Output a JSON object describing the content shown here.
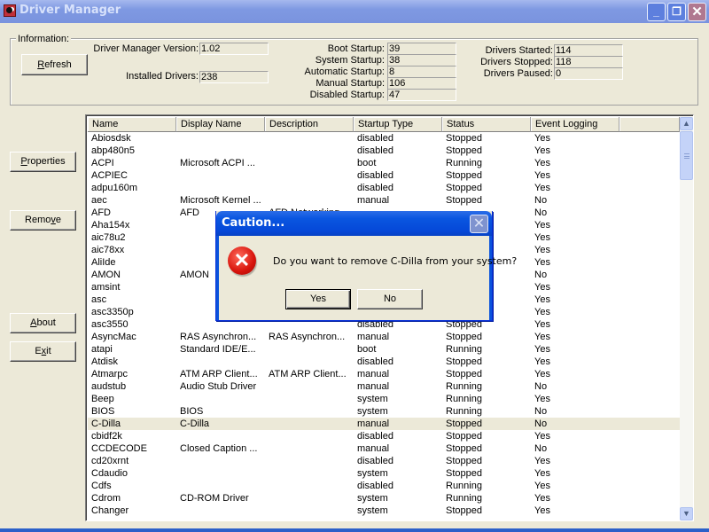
{
  "window": {
    "title": "Driver Manager",
    "controls": {
      "minimize": "_",
      "maximize": "❐",
      "close": "✕"
    }
  },
  "info": {
    "group_label": "Information:",
    "refresh_label_pre": "",
    "refresh_label_ul": "R",
    "refresh_label_post": "efresh",
    "version_label": "Driver Manager Version:",
    "version_value": "1.02",
    "installed_label": "Installed Drivers:",
    "installed_value": "238",
    "startup": [
      {
        "label": "Boot Startup:",
        "value": "39"
      },
      {
        "label": "System Startup:",
        "value": "38"
      },
      {
        "label": "Automatic Startup:",
        "value": "8"
      },
      {
        "label": "Manual Startup:",
        "value": "106"
      },
      {
        "label": "Disabled Startup:",
        "value": "47"
      }
    ],
    "status": [
      {
        "label": "Drivers Started:",
        "value": "114"
      },
      {
        "label": "Drivers Stopped:",
        "value": "118"
      },
      {
        "label": "Drivers Paused:",
        "value": "0"
      }
    ]
  },
  "side_buttons": {
    "properties": {
      "pre": "",
      "ul": "P",
      "post": "roperties"
    },
    "remove": {
      "pre": "Remo",
      "ul": "v",
      "post": "e"
    },
    "about": {
      "pre": "",
      "ul": "A",
      "post": "bout"
    },
    "exit": {
      "pre": "E",
      "ul": "x",
      "post": "it"
    }
  },
  "list": {
    "columns": [
      "Name",
      "Display Name",
      "Description",
      "Startup Type",
      "Status",
      "Event Logging",
      ""
    ],
    "selected_index": 23,
    "rows": [
      [
        "Abiosdsk",
        "",
        "",
        "disabled",
        "Stopped",
        "Yes"
      ],
      [
        "abp480n5",
        "",
        "",
        "disabled",
        "Stopped",
        "Yes"
      ],
      [
        "ACPI",
        "Microsoft ACPI ...",
        "",
        "boot",
        "Running",
        "Yes"
      ],
      [
        "ACPIEC",
        "",
        "",
        "disabled",
        "Stopped",
        "Yes"
      ],
      [
        "adpu160m",
        "",
        "",
        "disabled",
        "Stopped",
        "Yes"
      ],
      [
        "aec",
        "Microsoft Kernel ...",
        "",
        "manual",
        "Stopped",
        "No"
      ],
      [
        "AFD",
        "AFD",
        "AFD Networking ...",
        "",
        "",
        "No"
      ],
      [
        "Aha154x",
        "",
        "",
        "",
        "",
        "Yes"
      ],
      [
        "aic78u2",
        "",
        "",
        "",
        "",
        "Yes"
      ],
      [
        "aic78xx",
        "",
        "",
        "",
        "",
        "Yes"
      ],
      [
        "AliIde",
        "",
        "",
        "",
        "",
        "Yes"
      ],
      [
        "AMON",
        "AMON",
        "",
        "",
        "",
        "No"
      ],
      [
        "amsint",
        "",
        "",
        "",
        "",
        "Yes"
      ],
      [
        "asc",
        "",
        "",
        "",
        "",
        "Yes"
      ],
      [
        "asc3350p",
        "",
        "",
        "",
        "",
        "Yes"
      ],
      [
        "asc3550",
        "",
        "",
        "disabled",
        "Stopped",
        "Yes"
      ],
      [
        "AsyncMac",
        "RAS Asynchron...",
        "RAS Asynchron...",
        "manual",
        "Stopped",
        "Yes"
      ],
      [
        "atapi",
        "Standard IDE/E...",
        "",
        "boot",
        "Running",
        "Yes"
      ],
      [
        "Atdisk",
        "",
        "",
        "disabled",
        "Stopped",
        "Yes"
      ],
      [
        "Atmarpc",
        "ATM ARP Client...",
        "ATM ARP Client...",
        "manual",
        "Stopped",
        "Yes"
      ],
      [
        "audstub",
        "Audio Stub Driver",
        "",
        "manual",
        "Running",
        "No"
      ],
      [
        "Beep",
        "",
        "",
        "system",
        "Running",
        "Yes"
      ],
      [
        "BIOS",
        "BIOS",
        "",
        "system",
        "Running",
        "No"
      ],
      [
        "C-Dilla",
        "C-Dilla",
        "",
        "manual",
        "Stopped",
        "No"
      ],
      [
        "cbidf2k",
        "",
        "",
        "disabled",
        "Stopped",
        "Yes"
      ],
      [
        "CCDECODE",
        "Closed Caption ...",
        "",
        "manual",
        "Stopped",
        "No"
      ],
      [
        "cd20xrnt",
        "",
        "",
        "disabled",
        "Stopped",
        "Yes"
      ],
      [
        "Cdaudio",
        "",
        "",
        "system",
        "Stopped",
        "Yes"
      ],
      [
        "Cdfs",
        "",
        "",
        "disabled",
        "Running",
        "Yes"
      ],
      [
        "Cdrom",
        "CD-ROM Driver",
        "",
        "system",
        "Running",
        "Yes"
      ],
      [
        "Changer",
        "",
        "",
        "system",
        "Stopped",
        "Yes"
      ]
    ]
  },
  "dialog": {
    "title": "Caution...",
    "close": "✕",
    "icon": "error-icon",
    "message": "Do you want to remove C-Dilla from your system?",
    "yes_label": "Yes",
    "no_label": "No"
  }
}
